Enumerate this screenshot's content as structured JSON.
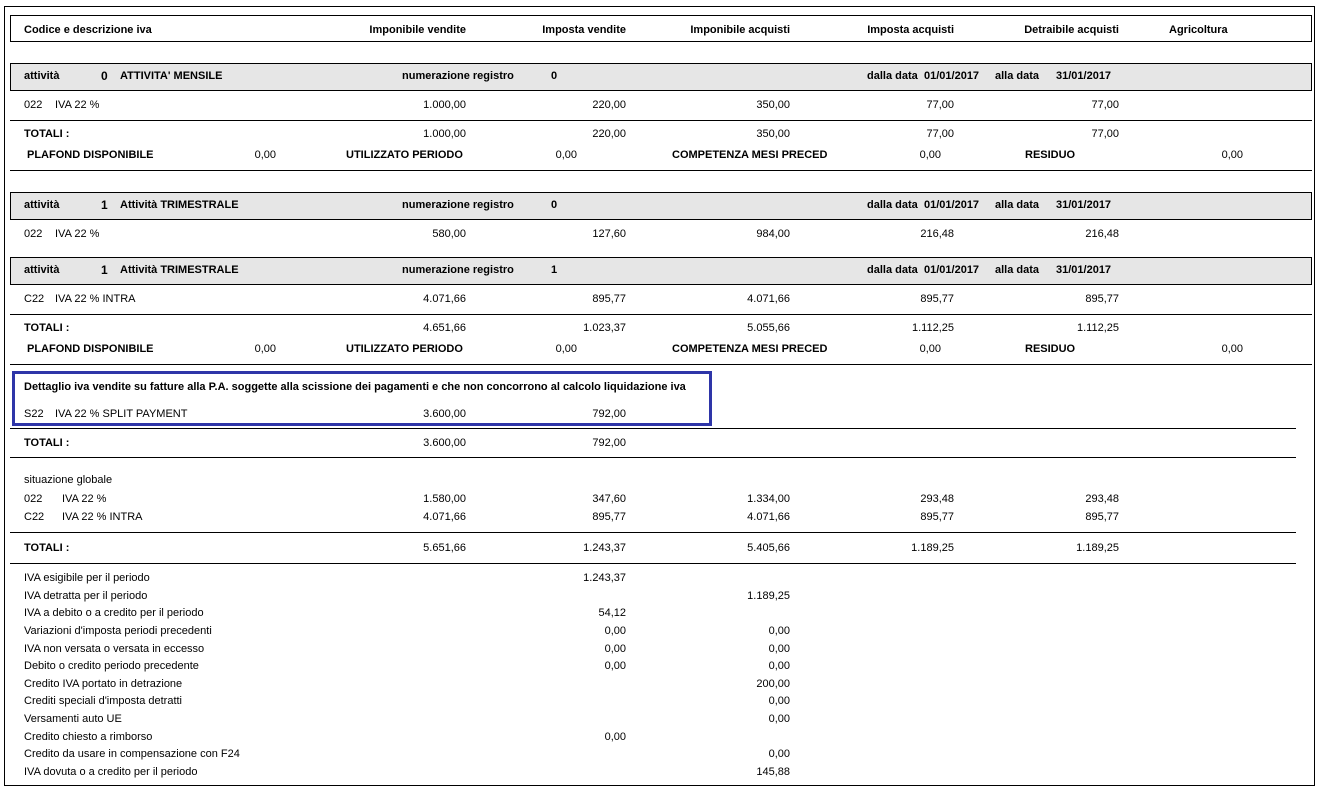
{
  "header": {
    "col_codice": "Codice e descrizione iva",
    "col_imp_vendite": "Imponibile vendite",
    "col_imposta_vendite": "Imposta vendite",
    "col_imp_acquisti": "Imponibile acquisti",
    "col_imposta_acquisti": "Imposta acquisti",
    "col_detraibile": "Detraibile acquisti",
    "col_agricoltura": "Agricoltura"
  },
  "labels": {
    "attivita": "attività",
    "numerazione": "numerazione registro",
    "dalla_data": "dalla data",
    "alla_data": "alla data",
    "totali": "TOTALI :",
    "plafond": "PLAFOND DISPONIBILE",
    "utilizzato": "UTILIZZATO PERIODO",
    "competenza": "COMPETENZA MESI PRECED",
    "residuo": "RESIDUO"
  },
  "sec1": {
    "num": "0",
    "name": "ATTIVITA' MENSILE",
    "registro": "0",
    "dal": "01/01/2017",
    "al": "31/01/2017",
    "row": {
      "code": "022",
      "desc": "IVA 22 %",
      "iv": "1.000,00",
      "imv": "220,00",
      "ia": "350,00",
      "ima": "77,00",
      "det": "77,00"
    },
    "tot": {
      "iv": "1.000,00",
      "imv": "220,00",
      "ia": "350,00",
      "ima": "77,00",
      "det": "77,00"
    },
    "plafond": {
      "disp": "0,00",
      "util": "0,00",
      "comp": "0,00",
      "res": "0,00"
    }
  },
  "sec2": {
    "num": "1",
    "name": "Attività TRIMESTRALE",
    "registro": "0",
    "dal": "01/01/2017",
    "al": "31/01/2017",
    "row": {
      "code": "022",
      "desc": "IVA 22 %",
      "iv": "580,00",
      "imv": "127,60",
      "ia": "984,00",
      "ima": "216,48",
      "det": "216,48"
    }
  },
  "sec3": {
    "num": "1",
    "name": "Attività TRIMESTRALE",
    "registro": "1",
    "dal": "01/01/2017",
    "al": "31/01/2017",
    "row": {
      "code": "C22",
      "desc": "IVA 22 % INTRA",
      "iv": "4.071,66",
      "imv": "895,77",
      "ia": "4.071,66",
      "ima": "895,77",
      "det": "895,77"
    },
    "tot": {
      "iv": "4.651,66",
      "imv": "1.023,37",
      "ia": "5.055,66",
      "ima": "1.112,25",
      "det": "1.112,25"
    },
    "plafond": {
      "disp": "0,00",
      "util": "0,00",
      "comp": "0,00",
      "res": "0,00"
    }
  },
  "split": {
    "title": "Dettaglio iva vendite su fatture alla P.A. soggette alla scissione dei pagamenti e che non concorrono al calcolo liquidazione iva",
    "row": {
      "code": "S22",
      "desc": "IVA 22 % SPLIT PAYMENT",
      "iv": "3.600,00",
      "imv": "792,00"
    },
    "tot": {
      "iv": "3.600,00",
      "imv": "792,00"
    }
  },
  "globale": {
    "title": "situazione globale",
    "rows": [
      {
        "code": "022",
        "desc": "IVA 22 %",
        "iv": "1.580,00",
        "imv": "347,60",
        "ia": "1.334,00",
        "ima": "293,48",
        "det": "293,48"
      },
      {
        "code": "C22",
        "desc": "IVA 22 % INTRA",
        "iv": "4.071,66",
        "imv": "895,77",
        "ia": "4.071,66",
        "ima": "895,77",
        "det": "895,77"
      }
    ],
    "tot": {
      "iv": "5.651,66",
      "imv": "1.243,37",
      "ia": "5.405,66",
      "ima": "1.189,25",
      "det": "1.189,25"
    }
  },
  "summary": [
    {
      "label": "IVA esigibile per il periodo",
      "c1": "1.243,37",
      "c2": ""
    },
    {
      "label": "IVA detratta per il periodo",
      "c1": "",
      "c2": "1.189,25"
    },
    {
      "label": "IVA a debito o a credito per il periodo",
      "c1": "54,12",
      "c2": ""
    },
    {
      "label": "Variazioni d'imposta periodi precedenti",
      "c1": "0,00",
      "c2": "0,00"
    },
    {
      "label": "IVA non versata o versata in eccesso",
      "c1": "0,00",
      "c2": "0,00"
    },
    {
      "label": "Debito o credito periodo precedente",
      "c1": "0,00",
      "c2": "0,00"
    },
    {
      "label": "Credito IVA portato in detrazione",
      "c1": "",
      "c2": "200,00"
    },
    {
      "label": "Crediti speciali d'imposta detratti",
      "c1": "",
      "c2": "0,00"
    },
    {
      "label": "Versamenti auto UE",
      "c1": "",
      "c2": "0,00"
    },
    {
      "label": "Credito chiesto a rimborso",
      "c1": "0,00",
      "c2": ""
    },
    {
      "label": "Credito da usare in compensazione con F24",
      "c1": "",
      "c2": "0,00"
    },
    {
      "label": "IVA dovuta o a credito per il periodo",
      "c1": "",
      "c2": "145,88"
    }
  ]
}
